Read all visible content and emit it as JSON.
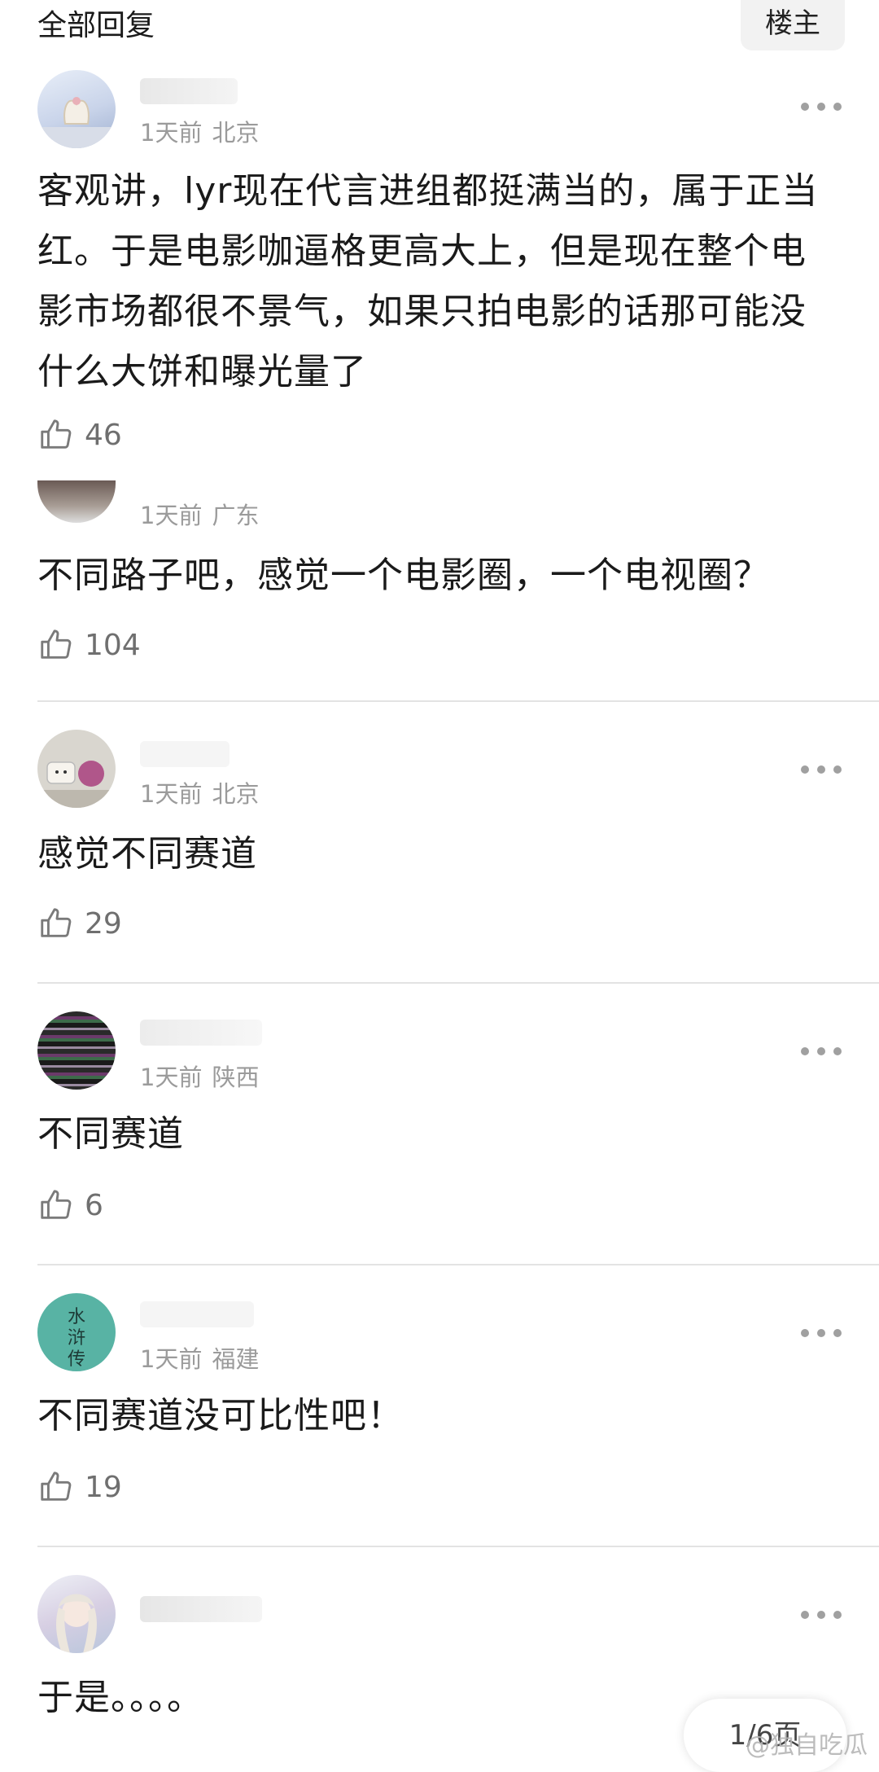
{
  "header": {
    "all_replies": "全部回复",
    "op_label": "楼主"
  },
  "comments": [
    {
      "username": "",
      "time": "1天前",
      "location": "北京",
      "text": "客观讲，lyr现在代言进组都挺满当的，属于正当红。于是电影咖逼格更高大上，但是现在整个电影市场都很不景气，如果只拍电影的话那可能没什么大饼和曝光量了",
      "likes": "46",
      "avatar_icon": "swan-avatar-icon"
    },
    {
      "username": "",
      "time": "1天前",
      "location": "广东",
      "text": "不同路子吧，感觉一个电影圈，一个电视圈？",
      "likes": "104",
      "avatar_icon": "photo-avatar-icon"
    },
    {
      "username": "",
      "time": "1天前",
      "location": "北京",
      "text": "感觉不同赛道",
      "likes": "29",
      "avatar_icon": "cat-avatar-icon"
    },
    {
      "username": "",
      "time": "1天前",
      "location": "陕西",
      "text": "不同赛道",
      "likes": "6",
      "avatar_icon": "glitch-avatar-icon"
    },
    {
      "username": "",
      "time": "1天前",
      "location": "福建",
      "text": "不同赛道没可比性吧！",
      "likes": "19",
      "avatar_icon": "calligraphy-avatar-icon"
    },
    {
      "username": "",
      "time": "",
      "location": "",
      "text": "于是。。。。",
      "likes": "",
      "avatar_icon": "anime-avatar-icon"
    }
  ],
  "pagination": {
    "label": "1/6页"
  },
  "watermark": {
    "text": "@独自吃瓜"
  },
  "colors": {
    "meta_gray": "#9b9b9b",
    "divider": "#e3e3e3",
    "icon_gray": "#a0a0a0"
  }
}
